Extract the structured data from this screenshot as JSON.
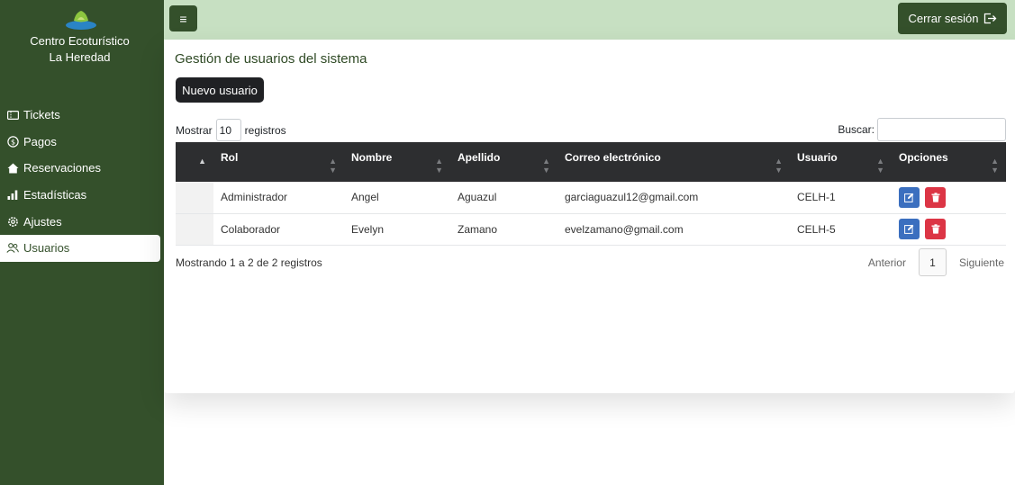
{
  "sidebar": {
    "brand_line1": "Centro Ecoturístico",
    "brand_line2": "La Heredad",
    "items": [
      {
        "label": "Tickets",
        "icon": "ticket-icon"
      },
      {
        "label": "Pagos",
        "icon": "dollar-icon"
      },
      {
        "label": "Reservaciones",
        "icon": "house-icon"
      },
      {
        "label": "Estadísticas",
        "icon": "bar-chart-icon"
      },
      {
        "label": "Ajustes",
        "icon": "gear-icon"
      },
      {
        "label": "Usuarios",
        "icon": "users-icon",
        "active": true
      }
    ]
  },
  "topbar": {
    "menu_icon": "hamburger-icon",
    "logout_label": "Cerrar sesión"
  },
  "main": {
    "title": "Gestión de usuarios del sistema",
    "new_user_label": "Nuevo usuario",
    "length_prefix": "Mostrar",
    "length_value": "10",
    "length_suffix": "registros",
    "search_label": "Buscar:",
    "columns": [
      "Rol",
      "Nombre",
      "Apellido",
      "Correo electrónico",
      "Usuario",
      "Opciones"
    ],
    "rows": [
      {
        "rol": "Administrador",
        "nombre": "Angel",
        "apellido": "Aguazul",
        "correo": "garciaguazul12@gmail.com",
        "usuario": "CELH-1"
      },
      {
        "rol": "Colaborador",
        "nombre": "Evelyn",
        "apellido": "Zamano",
        "correo": "evelzamano@gmail.com",
        "usuario": "CELH-5"
      }
    ],
    "info": "Mostrando 1 a 2 de 2 registros",
    "pager": {
      "prev": "Anterior",
      "current": "1",
      "next": "Siguiente"
    }
  },
  "colors": {
    "sidebar": "#34502b",
    "topbar": "#c7e0c2",
    "table_header": "#2d2e30",
    "edit": "#3b6fbf",
    "delete": "#dc3545"
  }
}
